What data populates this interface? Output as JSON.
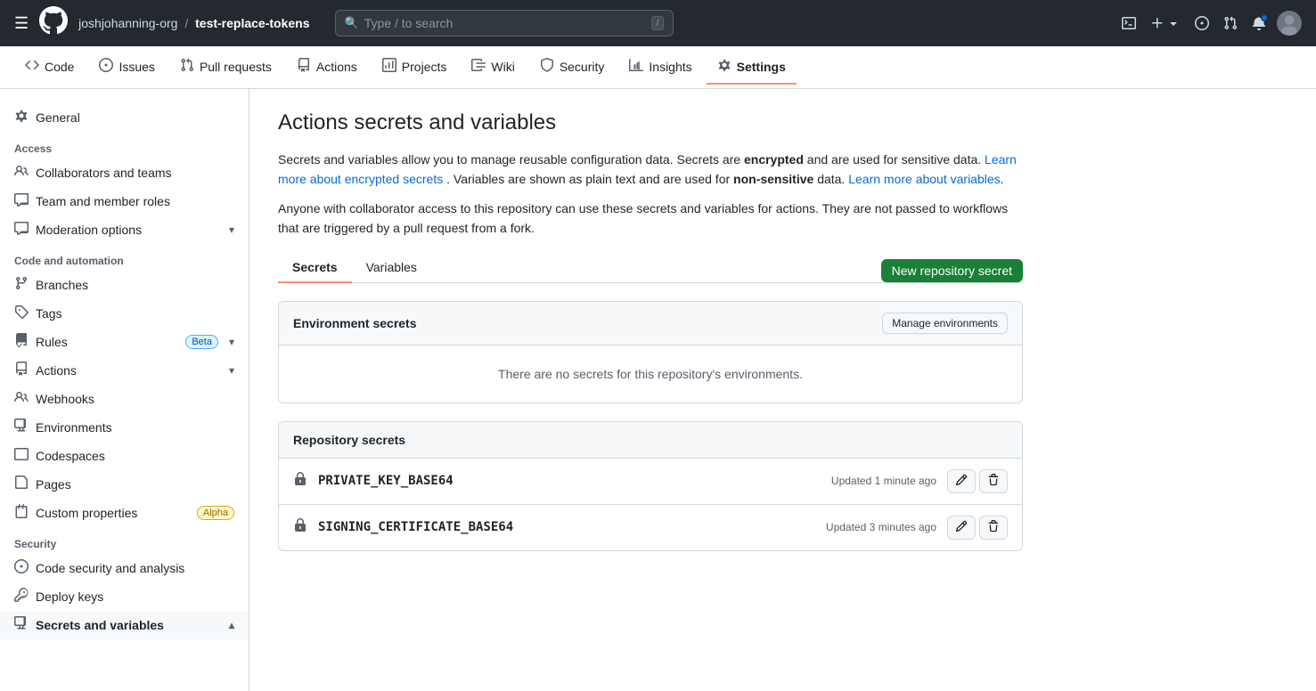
{
  "topbar": {
    "repo_owner": "joshjohanning-org",
    "repo_name": "test-replace-tokens",
    "search_placeholder": "Type / to search",
    "plus_label": "+",
    "icons": {
      "hamburger": "☰",
      "search": "🔍",
      "terminal": "⌨",
      "plus": "+",
      "chevron_down": "▾",
      "issues": "⊙",
      "prs": "🔀",
      "notifications": "🔔"
    }
  },
  "subnav": {
    "items": [
      {
        "id": "code",
        "label": "Code",
        "icon": "<>"
      },
      {
        "id": "issues",
        "label": "Issues",
        "icon": "⊙"
      },
      {
        "id": "pull-requests",
        "label": "Pull requests",
        "icon": "⎇"
      },
      {
        "id": "actions",
        "label": "Actions",
        "icon": "▶"
      },
      {
        "id": "projects",
        "label": "Projects",
        "icon": "⊞"
      },
      {
        "id": "wiki",
        "label": "Wiki",
        "icon": "📖"
      },
      {
        "id": "security",
        "label": "Security",
        "icon": "🛡"
      },
      {
        "id": "insights",
        "label": "Insights",
        "icon": "📈"
      },
      {
        "id": "settings",
        "label": "Settings",
        "icon": "⚙",
        "active": true
      }
    ]
  },
  "sidebar": {
    "items": [
      {
        "id": "general",
        "label": "General",
        "icon": "⚙",
        "section": null
      },
      {
        "id": "access-section",
        "label": "Access",
        "section_header": true
      },
      {
        "id": "collaborators",
        "label": "Collaborators and teams",
        "icon": "👤"
      },
      {
        "id": "member-roles",
        "label": "Team and member roles",
        "icon": "📋"
      },
      {
        "id": "moderation",
        "label": "Moderation options",
        "icon": "💬",
        "has_chevron": true
      },
      {
        "id": "code-automation-section",
        "label": "Code and automation",
        "section_header": true
      },
      {
        "id": "branches",
        "label": "Branches",
        "icon": "⎇"
      },
      {
        "id": "tags",
        "label": "Tags",
        "icon": "🏷"
      },
      {
        "id": "rules",
        "label": "Rules",
        "icon": "📏",
        "badge": "Beta",
        "badge_type": "beta",
        "has_chevron": true
      },
      {
        "id": "actions",
        "label": "Actions",
        "icon": "▶",
        "has_chevron": true
      },
      {
        "id": "webhooks",
        "label": "Webhooks",
        "icon": "🔗"
      },
      {
        "id": "environments",
        "label": "Environments",
        "icon": "⊞"
      },
      {
        "id": "codespaces",
        "label": "Codespaces",
        "icon": "⬛"
      },
      {
        "id": "pages",
        "label": "Pages",
        "icon": "📄"
      },
      {
        "id": "custom-properties",
        "label": "Custom properties",
        "icon": "✦",
        "badge": "Alpha",
        "badge_type": "alpha"
      },
      {
        "id": "security-section",
        "label": "Security",
        "section_header": true
      },
      {
        "id": "code-security",
        "label": "Code security and analysis",
        "icon": "🔍"
      },
      {
        "id": "deploy-keys",
        "label": "Deploy keys",
        "icon": "🔑"
      },
      {
        "id": "secrets-variables",
        "label": "Secrets and variables",
        "icon": "⊞",
        "has_chevron": true,
        "active": true
      }
    ]
  },
  "main": {
    "title": "Actions secrets and variables",
    "description1": "Secrets and variables allow you to manage reusable configuration data. Secrets are",
    "description1_bold": "encrypted",
    "description1_rest": "and are used for sensitive data.",
    "link1": "Learn more about encrypted secrets",
    "link1_url": "#",
    "description2": ". Variables are shown as plain text and are used for",
    "description2_bold": "non-sensitive",
    "description2_rest": "data.",
    "link2": "Learn more about variables",
    "link2_url": "#",
    "description3": "Anyone with collaborator access to this repository can use these secrets and variables for actions. They are not passed to workflows that are triggered by a pull request from a fork.",
    "tabs": [
      {
        "id": "secrets",
        "label": "Secrets",
        "active": true
      },
      {
        "id": "variables",
        "label": "Variables",
        "active": false
      }
    ],
    "new_secret_btn": "New repository secret",
    "environment_secrets": {
      "title": "Environment secrets",
      "manage_btn": "Manage environments",
      "empty_msg": "There are no secrets for this repository's environments."
    },
    "repository_secrets": {
      "title": "Repository secrets",
      "secrets": [
        {
          "name": "PRIVATE_KEY_BASE64",
          "updated": "Updated 1 minute ago"
        },
        {
          "name": "SIGNING_CERTIFICATE_BASE64",
          "updated": "Updated 3 minutes ago"
        }
      ]
    }
  }
}
